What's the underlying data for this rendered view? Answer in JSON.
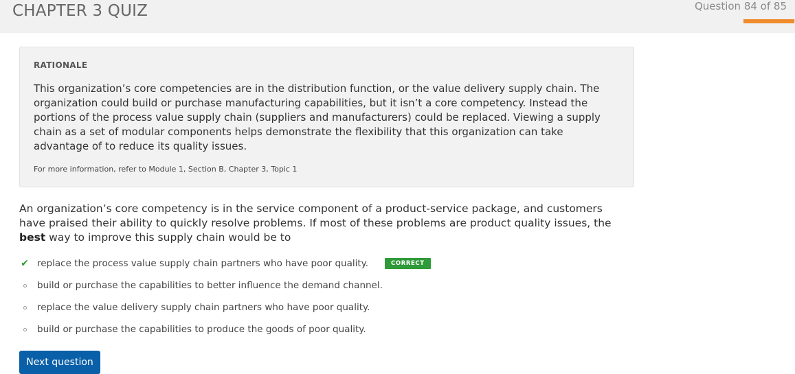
{
  "header": {
    "title": "CHAPTER 3 QUIZ",
    "progress_text": "Question 84 of 85",
    "progress_fraction": 0.988,
    "accent_color": "#f08c2e"
  },
  "rationale": {
    "heading": "RATIONALE",
    "body": "This organization’s core competencies are in the distribution function, or the value delivery supply chain. The organization could build or purchase manufacturing capabilities, but it isn’t a core competency. Instead the portions of the process value supply chain (suppliers and manufacturers) could be replaced. Viewing a supply chain as a set of modular components helps demonstrate the flexibility that this organization can take advantage of to reduce its quality issues.",
    "reference": "For more information, refer to Module 1, Section B, Chapter 3, Topic 1"
  },
  "question": {
    "text_before": "An organization’s core competency is in the service component of a product-service package, and customers have praised their ability to quickly resolve problems. If most of these problems are product quality issues, the ",
    "emphasis": "best",
    "text_after": " way to improve this supply chain would be to"
  },
  "answers": [
    {
      "text": "replace the process value supply chain partners who have poor quality.",
      "icon": "check-icon",
      "badge": "CORRECT",
      "badge_color": "#2f9a39"
    },
    {
      "text": "build or purchase the capabilities to better influence the demand channel.",
      "icon": "bullet-icon"
    },
    {
      "text": "replace the value delivery supply chain partners who have poor quality.",
      "icon": "bullet-icon"
    },
    {
      "text": "build or purchase the capabilities to produce the goods of poor quality.",
      "icon": "bullet-icon"
    }
  ],
  "next_button": {
    "label": "Next question",
    "color": "#0a60a8"
  }
}
